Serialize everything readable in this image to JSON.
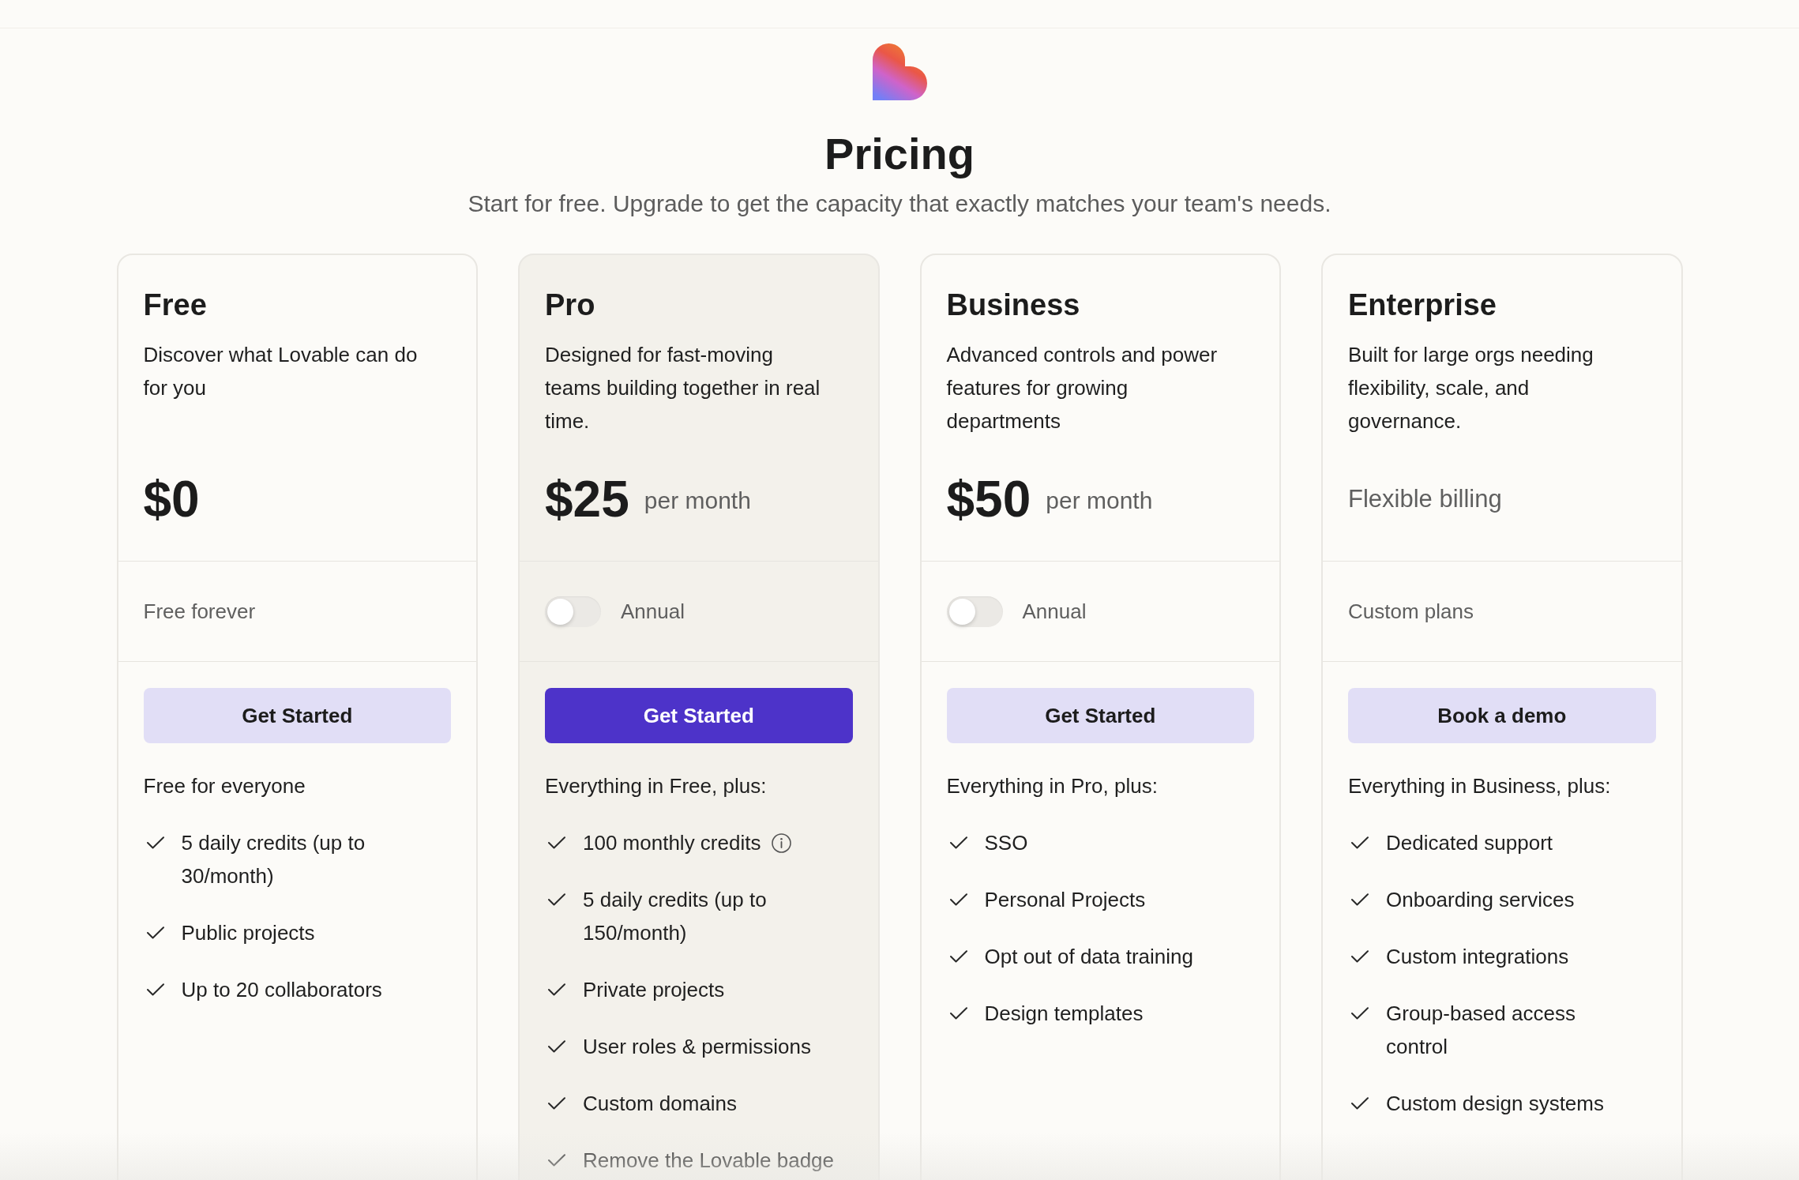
{
  "header": {
    "title": "Pricing",
    "subtitle": "Start for free. Upgrade to get the capacity that exactly matches your team's needs."
  },
  "plans": [
    {
      "name": "Free",
      "highlighted": false,
      "description": "Discover what Lovable can do for you",
      "price": {
        "kind": "amount",
        "amount": "$0"
      },
      "billing": {
        "kind": "text",
        "text": "Free forever"
      },
      "cta": {
        "label": "Get Started",
        "primary": false
      },
      "features_heading": "Free for everyone",
      "features": [
        {
          "text": "5 daily credits (up to 30/month)",
          "info": false
        },
        {
          "text": "Public projects",
          "info": false
        },
        {
          "text": "Up to 20 collaborators",
          "info": false
        }
      ]
    },
    {
      "name": "Pro",
      "highlighted": true,
      "description": "Designed for fast-moving teams building together in real time.",
      "price": {
        "kind": "amount",
        "amount": "$25",
        "period": "per month"
      },
      "billing": {
        "kind": "toggle",
        "label": "Annual",
        "on": false
      },
      "cta": {
        "label": "Get Started",
        "primary": true
      },
      "features_heading": "Everything in Free, plus:",
      "features": [
        {
          "text": "100 monthly credits",
          "info": true
        },
        {
          "text": "5 daily credits (up to 150/month)",
          "info": false
        },
        {
          "text": "Private projects",
          "info": false
        },
        {
          "text": "User roles & permissions",
          "info": false
        },
        {
          "text": "Custom domains",
          "info": false
        },
        {
          "text": "Remove the Lovable badge",
          "info": false
        }
      ]
    },
    {
      "name": "Business",
      "highlighted": false,
      "description": "Advanced controls and power features for growing departments",
      "price": {
        "kind": "amount",
        "amount": "$50",
        "period": "per month"
      },
      "billing": {
        "kind": "toggle",
        "label": "Annual",
        "on": false
      },
      "cta": {
        "label": "Get Started",
        "primary": false
      },
      "features_heading": "Everything in Pro, plus:",
      "features": [
        {
          "text": "SSO",
          "info": false
        },
        {
          "text": "Personal Projects",
          "info": false
        },
        {
          "text": "Opt out of data training",
          "info": false
        },
        {
          "text": "Design templates",
          "info": false
        }
      ]
    },
    {
      "name": "Enterprise",
      "highlighted": false,
      "description": "Built for large orgs needing flexibility, scale, and governance.",
      "price": {
        "kind": "note",
        "text": "Flexible billing"
      },
      "billing": {
        "kind": "text",
        "text": "Custom plans"
      },
      "cta": {
        "label": "Book a demo",
        "primary": false
      },
      "features_heading": "Everything in Business, plus:",
      "features": [
        {
          "text": "Dedicated support",
          "info": false
        },
        {
          "text": "Onboarding services",
          "info": false
        },
        {
          "text": "Custom integrations",
          "info": false
        },
        {
          "text": "Group-based access control",
          "info": false
        },
        {
          "text": "Custom design systems",
          "info": false
        }
      ]
    }
  ]
}
